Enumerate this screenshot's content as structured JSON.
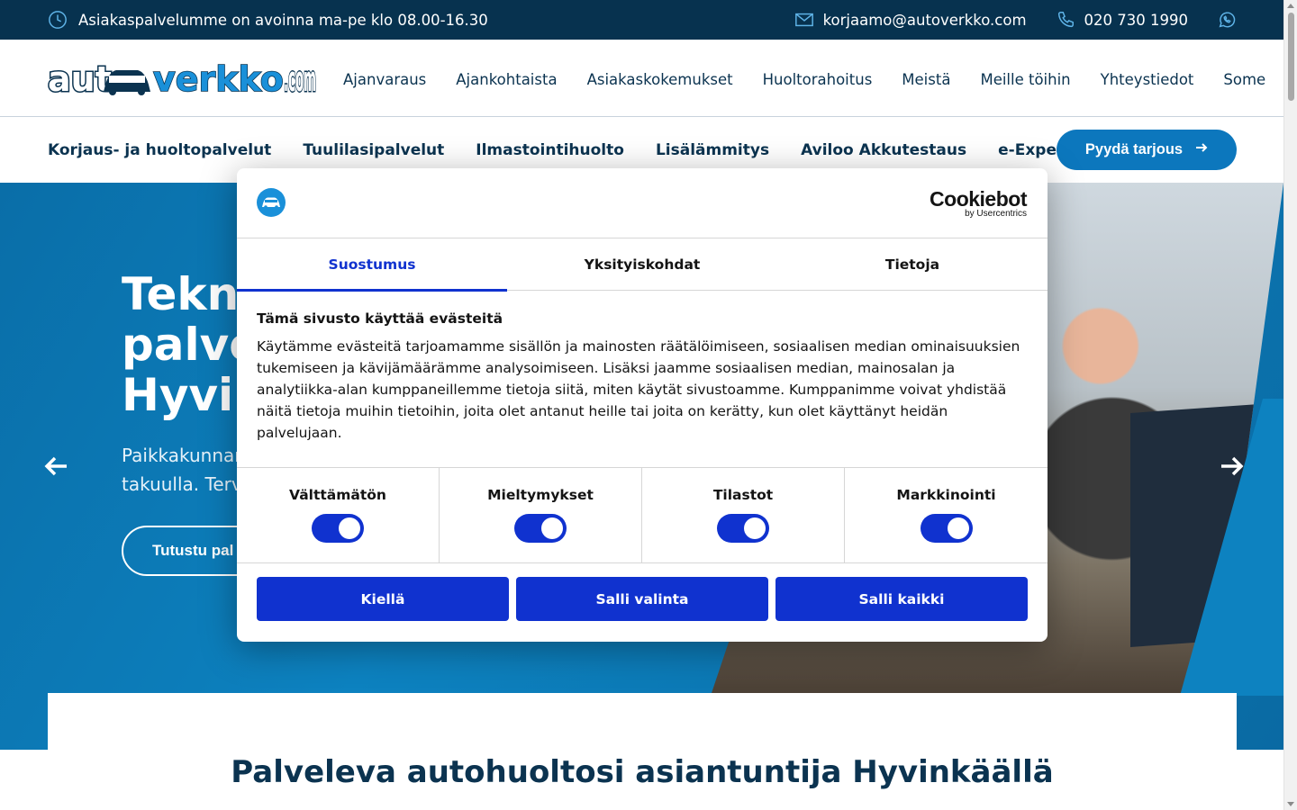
{
  "topbar": {
    "hours_text": "Asiakaspalvelumme on avoinna ma-pe klo 08.00-16.30",
    "email": "korjaamo@autoverkko.com",
    "phone": "020 730 1990"
  },
  "header": {
    "logo_text": "autoverkko.com",
    "nav": [
      "Ajanvaraus",
      "Ajankohtaista",
      "Asiakaskokemukset",
      "Huoltorahoitus",
      "Meistä",
      "Meille töihin",
      "Yhteystiedot",
      "Some"
    ]
  },
  "subnav": {
    "links": [
      "Korjaus- ja huoltopalvelut",
      "Tuulilasipalvelut",
      "Ilmastointihuolto",
      "Lisälämmitys",
      "Aviloo Akkutestaus",
      "e-Expert"
    ],
    "cta_label": "Pyydä tarjous"
  },
  "hero": {
    "title_lines": [
      "Teknis",
      "palve",
      "Hyvin"
    ],
    "text_lines": [
      "Paikkakunnar",
      "takuulla. Terv"
    ],
    "button_label": "Tutustu pal"
  },
  "section": {
    "heading": "Palveleva autohuoltosi asiantuntija Hyvinkäällä"
  },
  "cookie_dialog": {
    "brand": "Cookiebot",
    "brand_sub": "by Usercentrics",
    "tabs": [
      "Suostumus",
      "Yksityiskohdat",
      "Tietoja"
    ],
    "active_tab": "Suostumus",
    "heading": "Tämä sivusto käyttää evästeitä",
    "body": "Käytämme evästeitä tarjoamamme sisällön ja mainosten räätälöimiseen, sosiaalisen median ominaisuuksien tukemiseen ja kävijämäärämme analysoimiseen. Lisäksi jaamme sosiaalisen median, mainosalan ja analytiikka-alan kumppaneillemme tietoja siitä, miten käytät sivustoamme. Kumppanimme voivat yhdistää näitä tietoja muihin tietoihin, joita olet antanut heille tai joita on kerätty, kun olet käyttänyt heidän palvelujaan.",
    "toggles": [
      {
        "label": "Välttämätön",
        "on": true
      },
      {
        "label": "Mieltymykset",
        "on": true
      },
      {
        "label": "Tilastot",
        "on": true
      },
      {
        "label": "Markkinointi",
        "on": true
      }
    ],
    "buttons": {
      "deny": "Kiellä",
      "allow_selection": "Salli valinta",
      "allow_all": "Salli kaikki"
    },
    "accent_color": "#1032cf"
  },
  "colors": {
    "topbar_bg": "#07324f",
    "brand_blue": "#0c77bd",
    "text_dark": "#0b3350"
  }
}
